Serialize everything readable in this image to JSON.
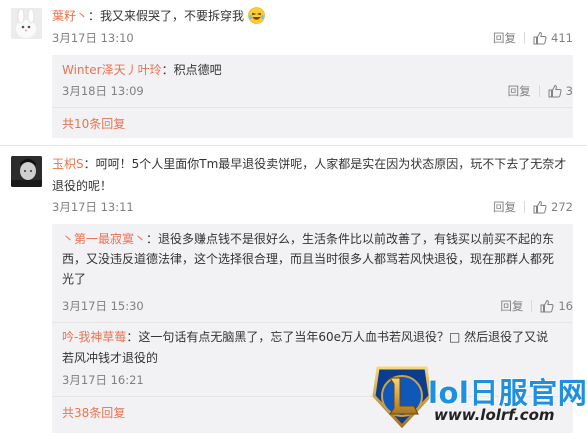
{
  "comment1": {
    "username": "葉籽丶",
    "text": "：我又来假哭了，不要拆穿我",
    "emoji": "laugh-cry-emoji",
    "date": "3月17日 13:10",
    "reply_label": "回复",
    "like_count": "411",
    "replies": [
      {
        "username": "Winter泽天丿叶玲",
        "text": "：积点德吧",
        "date": "3月18日 13:09",
        "reply_label": "回复",
        "like_count": "3"
      }
    ],
    "more_link": "共10条回复"
  },
  "comment2": {
    "username": "玉枳S",
    "text_line1": "：呵呵！5个人里面你Tm最早退役卖饼呢，人家都是实在因为状态原因，玩不下去了无奈才",
    "text_line2": "退役的呢！",
    "date": "3月17日 13:11",
    "reply_label": "回复",
    "like_count": "272",
    "replies": [
      {
        "username": "丶第一最寂寞丶",
        "text_line1": "：退役多赚点钱不是很好么，生活条件比以前改善了，有钱买以前买不起的东",
        "text_line2": "西，又没违反道德法律，这个选择很合理，而且当时很多人都骂若风快退役，现在那群人都死",
        "text_line3": "光了",
        "date": "3月17日 15:30",
        "reply_label": "回复",
        "like_count": "16"
      },
      {
        "username": "吟-我神草莓",
        "text_line1": "：这一句话有点无脑黑了，忘了当年60e万人血书若风退役？□   然后退役了又说",
        "text_line2": "若风冲钱才退役的",
        "date": "3月17日 16:21",
        "reply_label": "回复",
        "like_count": ""
      }
    ],
    "more_link": "共38条回复"
  },
  "watermark": {
    "title": "lol日服官网",
    "url": "www.lolrf.com"
  },
  "colors": {
    "accent": "#eb7350",
    "reply_bg": "#f2f2f5",
    "muted": "#808080",
    "watermark_blue": "#1f8fe0"
  }
}
